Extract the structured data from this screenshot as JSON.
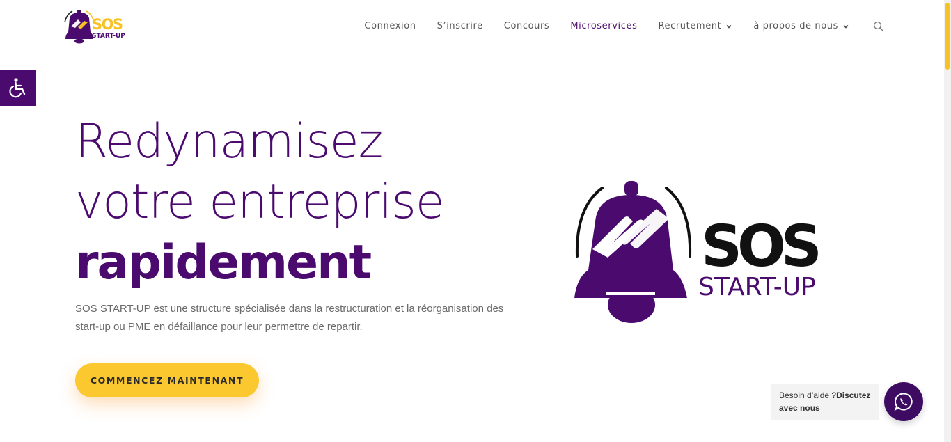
{
  "header": {
    "logo": {
      "brand_main": "SOS",
      "brand_sub": "START-UP"
    },
    "nav": [
      {
        "label": "Connexion",
        "has_dropdown": false,
        "active": false
      },
      {
        "label": "S’inscrire",
        "has_dropdown": false,
        "active": false
      },
      {
        "label": "Concours",
        "has_dropdown": false,
        "active": false
      },
      {
        "label": "Microservices",
        "has_dropdown": false,
        "active": true
      },
      {
        "label": "Recrutement",
        "has_dropdown": true,
        "active": false
      },
      {
        "label": "à propos de nous",
        "has_dropdown": true,
        "active": false
      }
    ],
    "search_icon": "search-icon"
  },
  "accessibility": {
    "icon": "wheelchair-icon"
  },
  "hero": {
    "title_line1": "Redynamisez",
    "title_line2": "votre entreprise",
    "title_line3": "rapidement",
    "description": "SOS START-UP est une structure spécialisée dans la restructuration et la réorganisation des start-up ou PME en défaillance pour leur permettre de repartir.",
    "cta_label": "COMMENCEZ MAINTENANT"
  },
  "hero_logo": {
    "brand_main": "SOS",
    "brand_sub": "START-UP"
  },
  "chat": {
    "text_regular": "Besoin d’aide ?",
    "text_bold": "Discutez avec nous",
    "icon": "whatsapp-icon"
  },
  "colors": {
    "brand_purple": "#4a0a6e",
    "accent_yellow": "#fbc82f",
    "text_gray": "#6b6b6b"
  }
}
